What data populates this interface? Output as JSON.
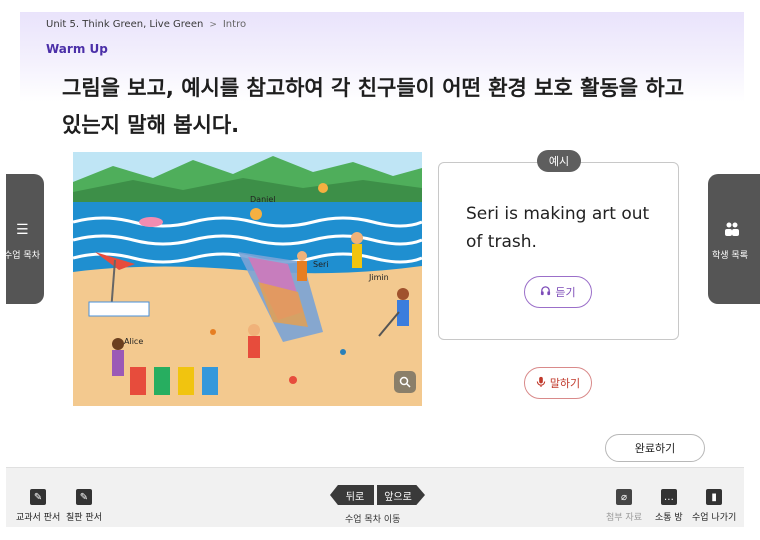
{
  "breadcrumb": {
    "unit": "Unit 5.  Think Green, Live Green",
    "separator": ">",
    "current": "Intro"
  },
  "section": {
    "label": "Warm Up"
  },
  "instruction": {
    "text": "그림을 보고, 예시를 참고하여 각 친구들이 어떤 환경 보호 활동을 하고 있는지 말해 봅시다."
  },
  "illustration": {
    "names": [
      "Daniel",
      "Seri",
      "Jimin",
      "Alice"
    ],
    "zoom_icon": "zoom-icon"
  },
  "example": {
    "tab_label": "예시",
    "sentence": "Seri is making art out of trash.",
    "listen_label": "듣기",
    "listen_icon": "headphones-icon",
    "speak_label": "말하기",
    "speak_icon": "microphone-icon"
  },
  "done_label": "완료하기",
  "side_left": {
    "label": "수업 목차",
    "icon": "list-icon"
  },
  "side_right": {
    "label": "학생 목록",
    "icon": "people-icon"
  },
  "bottom": {
    "tools_left": [
      {
        "label": "교과서 판서",
        "icon": "pen-edit-icon"
      },
      {
        "label": "칠판 판서",
        "icon": "board-edit-icon"
      }
    ],
    "nav": {
      "back": "뒤로",
      "forward": "앞으로",
      "label": "수업 목차 이동"
    },
    "tools_right": [
      {
        "label": "첨부 자료",
        "icon": "paperclip-icon"
      },
      {
        "label": "소통 방",
        "icon": "chat-icon"
      },
      {
        "label": "수업 나가기",
        "icon": "exit-door-icon"
      }
    ]
  },
  "colors": {
    "accent": "#4b2fa8",
    "listen": "#7c4bb8",
    "speak": "#c0392b",
    "sidebar": "#555555"
  }
}
